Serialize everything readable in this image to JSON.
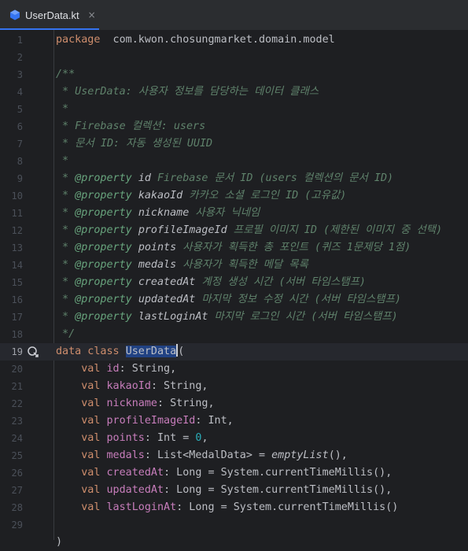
{
  "tab": {
    "title": "UserData.kt",
    "close_glyph": "×",
    "icon": "kotlin-file-icon",
    "accent": "#3574f0"
  },
  "editor": {
    "caret_line": 19,
    "gutter_icon": "implementations-icon",
    "lines": [
      {
        "n": "1",
        "segs": [
          [
            "kw",
            "package"
          ],
          [
            "",
            "  com.kwon.chosungmarket.domain.model"
          ]
        ]
      },
      {
        "n": "2",
        "segs": []
      },
      {
        "n": "3",
        "segs": [
          [
            "cm",
            "/**"
          ]
        ]
      },
      {
        "n": "4",
        "segs": [
          [
            "cm",
            " * UserData: 사용자 정보를 담당하는 데이터 클래스"
          ]
        ]
      },
      {
        "n": "5",
        "segs": [
          [
            "cm",
            " *"
          ]
        ]
      },
      {
        "n": "6",
        "segs": [
          [
            "cm",
            " * Firebase 컬렉션: users"
          ]
        ]
      },
      {
        "n": "7",
        "segs": [
          [
            "cm",
            " * 문서 ID: 자동 생성된 UUID"
          ]
        ]
      },
      {
        "n": "8",
        "segs": [
          [
            "cm",
            " *"
          ]
        ]
      },
      {
        "n": "9",
        "segs": [
          [
            "cm",
            " * "
          ],
          [
            "tag",
            "@property"
          ],
          [
            "cm",
            " "
          ],
          [
            "ctext",
            "id"
          ],
          [
            "cm",
            " Firebase 문서 ID (users 컬렉션의 문서 ID)"
          ]
        ]
      },
      {
        "n": "10",
        "segs": [
          [
            "cm",
            " * "
          ],
          [
            "tag",
            "@property"
          ],
          [
            "cm",
            " "
          ],
          [
            "ctext",
            "kakaoId"
          ],
          [
            "cm",
            " 카카오 소셜 로그인 ID (고유값)"
          ]
        ]
      },
      {
        "n": "11",
        "segs": [
          [
            "cm",
            " * "
          ],
          [
            "tag",
            "@property"
          ],
          [
            "cm",
            " "
          ],
          [
            "ctext",
            "nickname"
          ],
          [
            "cm",
            " 사용자 닉네임"
          ]
        ]
      },
      {
        "n": "12",
        "segs": [
          [
            "cm",
            " * "
          ],
          [
            "tag",
            "@property"
          ],
          [
            "cm",
            " "
          ],
          [
            "ctext",
            "profileImageId"
          ],
          [
            "cm",
            " 프로필 이미지 ID (제한된 이미지 중 선택)"
          ]
        ]
      },
      {
        "n": "13",
        "segs": [
          [
            "cm",
            " * "
          ],
          [
            "tag",
            "@property"
          ],
          [
            "cm",
            " "
          ],
          [
            "ctext",
            "points"
          ],
          [
            "cm",
            " 사용자가 획득한 총 포인트 (퀴즈 1문제당 1점)"
          ]
        ]
      },
      {
        "n": "14",
        "segs": [
          [
            "cm",
            " * "
          ],
          [
            "tag",
            "@property"
          ],
          [
            "cm",
            " "
          ],
          [
            "ctext",
            "medals"
          ],
          [
            "cm",
            " 사용자가 획득한 메달 목록"
          ]
        ]
      },
      {
        "n": "15",
        "segs": [
          [
            "cm",
            " * "
          ],
          [
            "tag",
            "@property"
          ],
          [
            "cm",
            " "
          ],
          [
            "ctext",
            "createdAt"
          ],
          [
            "cm",
            " 계정 생성 시간 (서버 타임스탬프)"
          ]
        ]
      },
      {
        "n": "16",
        "segs": [
          [
            "cm",
            " * "
          ],
          [
            "tag",
            "@property"
          ],
          [
            "cm",
            " "
          ],
          [
            "ctext",
            "updatedAt"
          ],
          [
            "cm",
            " 마지막 정보 수정 시간 (서버 타임스탬프)"
          ]
        ]
      },
      {
        "n": "17",
        "segs": [
          [
            "cm",
            " * "
          ],
          [
            "tag",
            "@property"
          ],
          [
            "cm",
            " "
          ],
          [
            "ctext",
            "lastLoginAt"
          ],
          [
            "cm",
            " 마지막 로그인 시간 (서버 타임스탬프)"
          ]
        ]
      },
      {
        "n": "18",
        "segs": [
          [
            "cm",
            " */"
          ]
        ]
      },
      {
        "n": "19",
        "segs": [
          [
            "kw",
            "data class "
          ],
          [
            "sel",
            "UserData"
          ],
          [
            "cursor",
            ""
          ],
          [
            "",
            "("
          ]
        ]
      },
      {
        "n": "20",
        "segs": [
          [
            "",
            "    "
          ],
          [
            "kw",
            "val "
          ],
          [
            "prop",
            "id"
          ],
          [
            "",
            ": String,"
          ]
        ]
      },
      {
        "n": "21",
        "segs": [
          [
            "",
            "    "
          ],
          [
            "kw",
            "val "
          ],
          [
            "prop",
            "kakaoId"
          ],
          [
            "",
            ": String,"
          ]
        ]
      },
      {
        "n": "22",
        "segs": [
          [
            "",
            "    "
          ],
          [
            "kw",
            "val "
          ],
          [
            "prop",
            "nickname"
          ],
          [
            "",
            ": String,"
          ]
        ]
      },
      {
        "n": "23",
        "segs": [
          [
            "",
            "    "
          ],
          [
            "kw",
            "val "
          ],
          [
            "prop",
            "profileImageId"
          ],
          [
            "",
            ": Int,"
          ]
        ]
      },
      {
        "n": "24",
        "segs": [
          [
            "",
            "    "
          ],
          [
            "kw",
            "val "
          ],
          [
            "prop",
            "points"
          ],
          [
            "",
            ": Int = "
          ],
          [
            "num",
            "0"
          ],
          [
            "",
            ","
          ]
        ]
      },
      {
        "n": "25",
        "segs": [
          [
            "",
            "    "
          ],
          [
            "kw",
            "val "
          ],
          [
            "prop",
            "medals"
          ],
          [
            "",
            ": List<MedalData> = "
          ],
          [
            "it",
            "emptyList"
          ],
          [
            "",
            "(),"
          ]
        ]
      },
      {
        "n": "26",
        "segs": [
          [
            "",
            "    "
          ],
          [
            "kw",
            "val "
          ],
          [
            "prop",
            "createdAt"
          ],
          [
            "",
            ": Long = System.currentTimeMillis(),"
          ]
        ]
      },
      {
        "n": "27",
        "segs": [
          [
            "",
            "    "
          ],
          [
            "kw",
            "val "
          ],
          [
            "prop",
            "updatedAt"
          ],
          [
            "",
            ": Long = System.currentTimeMillis(),"
          ]
        ]
      },
      {
        "n": "28",
        "segs": [
          [
            "",
            "    "
          ],
          [
            "kw",
            "val "
          ],
          [
            "prop",
            "lastLoginAt"
          ],
          [
            "",
            ": Long = System.currentTimeMillis()"
          ]
        ]
      },
      {
        "n": "29",
        "segs": []
      },
      {
        "n": "",
        "segs": [
          [
            "",
            ")"
          ]
        ]
      }
    ]
  }
}
